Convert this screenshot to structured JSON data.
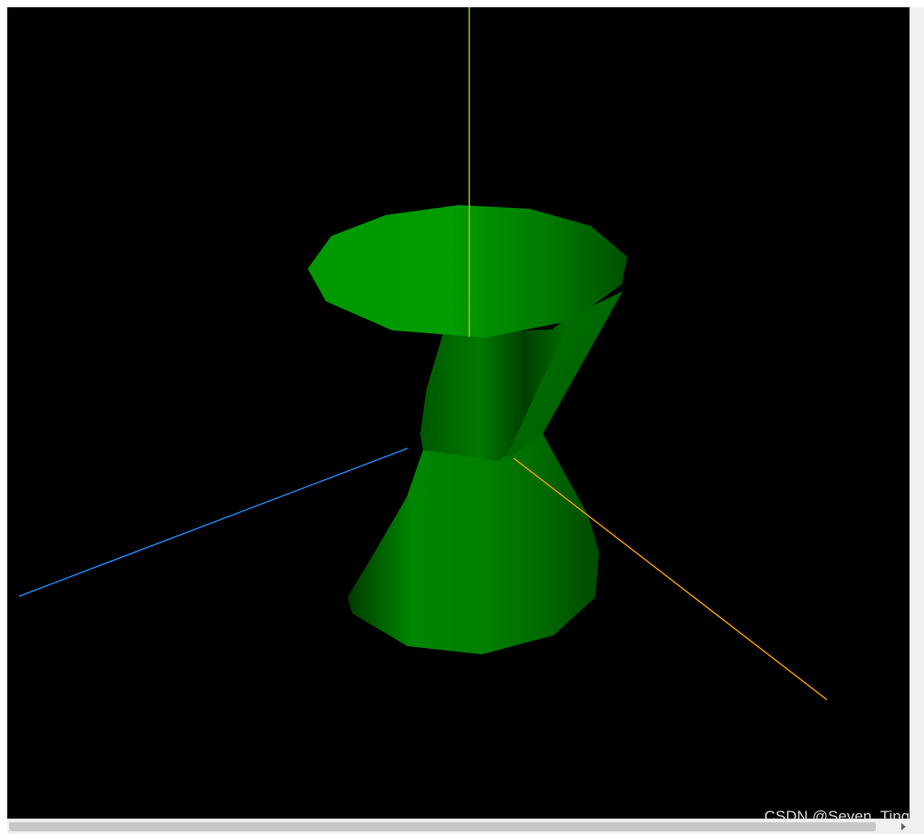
{
  "scene": {
    "background": "#000000",
    "object": "green hyperboloid mesh",
    "colors": {
      "mesh_light": "#00a000",
      "mesh_mid": "#008200",
      "mesh_dark": "#004400",
      "axis_y": "#9acd32",
      "axis_x": "#1e90ff",
      "axis_z": "#ffa500"
    }
  },
  "watermark": {
    "text": "CSDN @Seven_Ting"
  },
  "scrollbars": {
    "vertical": true,
    "horizontal": true,
    "icons": [
      "arrow-right-icon"
    ]
  }
}
